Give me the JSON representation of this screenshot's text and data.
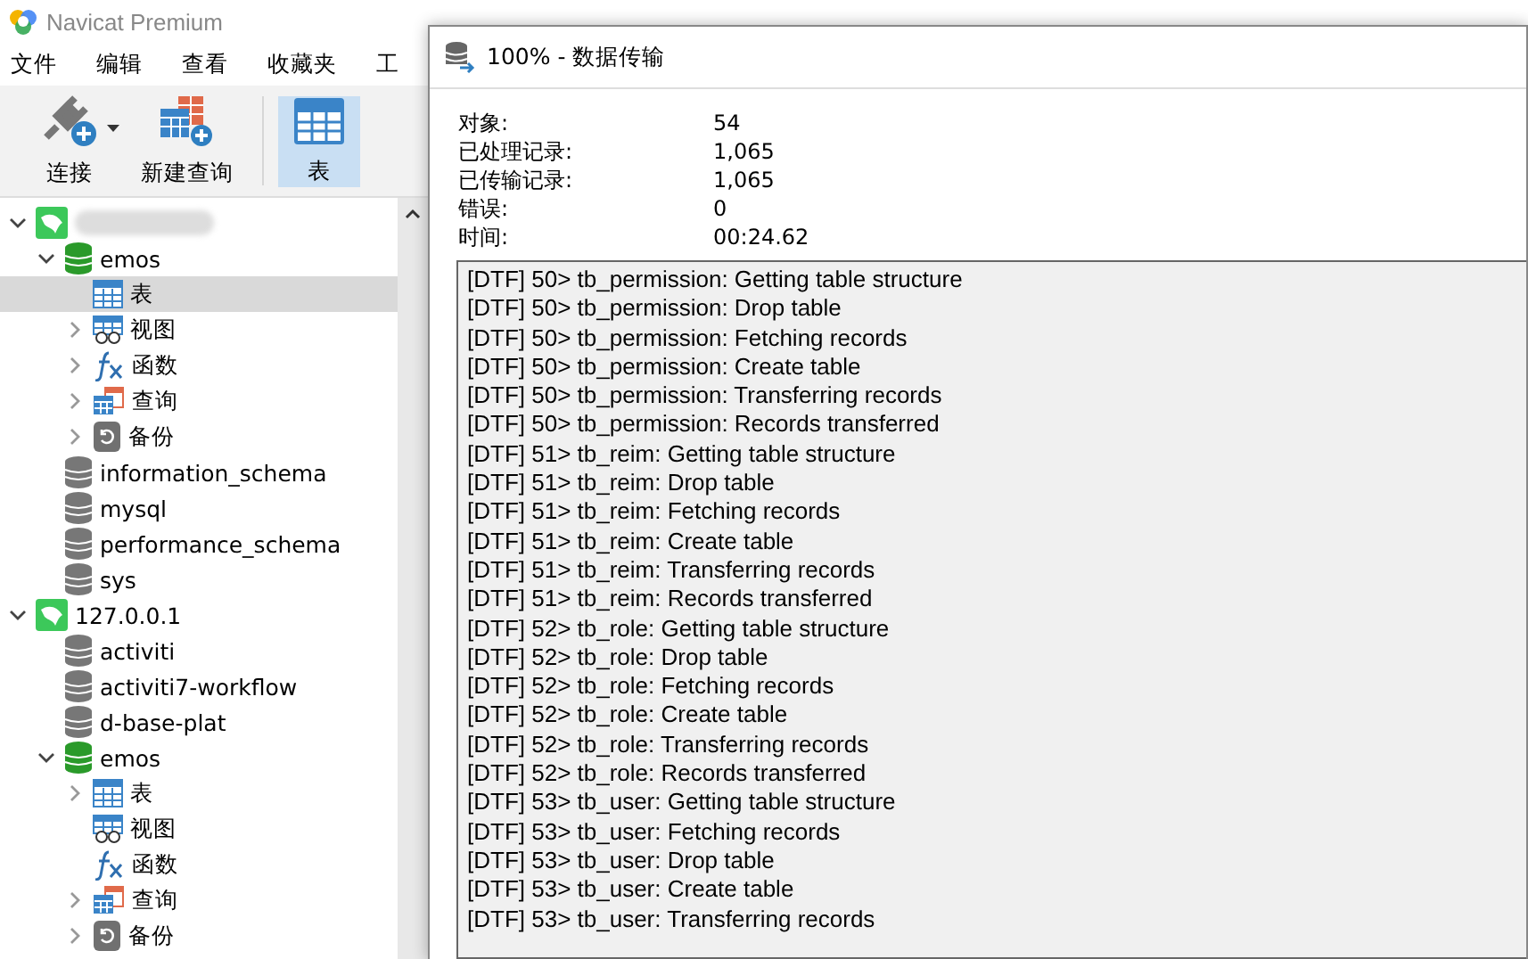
{
  "app": {
    "title": "Navicat Premium"
  },
  "menu": [
    "文件",
    "编辑",
    "查看",
    "收藏夹",
    "工"
  ],
  "toolbar": [
    {
      "label": "连接",
      "kind": "connect",
      "selected": false,
      "dropdown": true
    },
    {
      "label": "新建查询",
      "kind": "query",
      "selected": false,
      "dropdown": false
    },
    {
      "label": "表",
      "kind": "table",
      "selected": true,
      "dropdown": false
    }
  ],
  "tree": [
    {
      "kind": "connection",
      "blurred": true,
      "expandable": true,
      "expanded": true,
      "selected": false,
      "children": [
        {
          "kind": "database",
          "label": "emos",
          "active": true,
          "expandable": true,
          "expanded": true,
          "selected": false,
          "children": [
            {
              "kind": "table",
              "label": "表",
              "expandable": false,
              "selected": true
            },
            {
              "kind": "view",
              "label": "视图",
              "expandable": true,
              "expanded": false,
              "selected": false
            },
            {
              "kind": "function",
              "label": "函数",
              "expandable": true,
              "expanded": false,
              "selected": false
            },
            {
              "kind": "query",
              "label": "查询",
              "expandable": true,
              "expanded": false,
              "selected": false
            },
            {
              "kind": "backup",
              "label": "备份",
              "expandable": true,
              "expanded": false,
              "selected": false
            }
          ]
        },
        {
          "kind": "database",
          "label": "information_schema",
          "active": false,
          "expandable": false,
          "selected": false
        },
        {
          "kind": "database",
          "label": "mysql",
          "active": false,
          "expandable": false,
          "selected": false
        },
        {
          "kind": "database",
          "label": "performance_schema",
          "active": false,
          "expandable": false,
          "selected": false
        },
        {
          "kind": "database",
          "label": "sys",
          "active": false,
          "expandable": false,
          "selected": false
        }
      ]
    },
    {
      "kind": "connection",
      "label": "127.0.0.1",
      "blurred": false,
      "expandable": true,
      "expanded": true,
      "selected": false,
      "children": [
        {
          "kind": "database",
          "label": "activiti",
          "active": false,
          "expandable": false,
          "selected": false
        },
        {
          "kind": "database",
          "label": "activiti7-workflow",
          "active": false,
          "expandable": false,
          "selected": false
        },
        {
          "kind": "database",
          "label": "d-base-plat",
          "active": false,
          "expandable": false,
          "selected": false
        },
        {
          "kind": "database",
          "label": "emos",
          "active": true,
          "expandable": true,
          "expanded": true,
          "selected": false,
          "children": [
            {
              "kind": "table",
              "label": "表",
              "expandable": true,
              "expanded": false,
              "selected": false
            },
            {
              "kind": "view",
              "label": "视图",
              "expandable": false,
              "selected": false
            },
            {
              "kind": "function",
              "label": "函数",
              "expandable": false,
              "selected": false
            },
            {
              "kind": "query",
              "label": "查询",
              "expandable": true,
              "expanded": false,
              "selected": false
            },
            {
              "kind": "backup",
              "label": "备份",
              "expandable": true,
              "expanded": false,
              "selected": false
            }
          ]
        }
      ]
    }
  ],
  "dialog": {
    "title": "100% - 数据传输",
    "stats": [
      {
        "label": "对象:",
        "value": "54"
      },
      {
        "label": "已处理记录:",
        "value": "1,065"
      },
      {
        "label": "已传输记录:",
        "value": "1,065"
      },
      {
        "label": "错误:",
        "value": "0"
      },
      {
        "label": "时间:",
        "value": "00:24.62"
      }
    ],
    "log": [
      "[DTF] 50> tb_permission: Getting table structure",
      "[DTF] 50> tb_permission: Drop table",
      "[DTF] 50> tb_permission: Fetching records",
      "[DTF] 50> tb_permission: Create table",
      "[DTF] 50> tb_permission: Transferring records",
      "[DTF] 50> tb_permission: Records transferred",
      "[DTF] 51> tb_reim: Getting table structure",
      "[DTF] 51> tb_reim: Drop table",
      "[DTF] 51> tb_reim: Fetching records",
      "[DTF] 51> tb_reim: Create table",
      "[DTF] 51> tb_reim: Transferring records",
      "[DTF] 51> tb_reim: Records transferred",
      "[DTF] 52> tb_role: Getting table structure",
      "[DTF] 52> tb_role: Drop table",
      "[DTF] 52> tb_role: Fetching records",
      "[DTF] 52> tb_role: Create table",
      "[DTF] 52> tb_role: Transferring records",
      "[DTF] 52> tb_role: Records transferred",
      "[DTF] 53> tb_user: Getting table structure",
      "[DTF] 53> tb_user: Fetching records",
      "[DTF] 53> tb_user: Drop table",
      "[DTF] 53> tb_user: Create table",
      "[DTF] 53> tb_user: Transferring records"
    ]
  }
}
